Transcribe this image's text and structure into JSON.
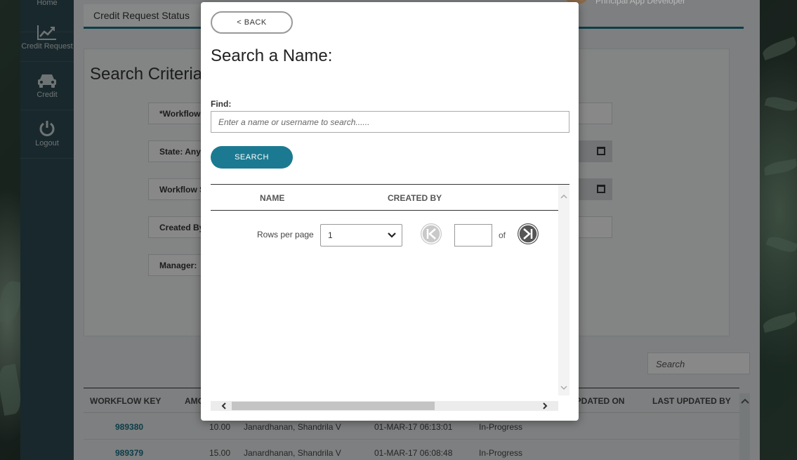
{
  "rail": {
    "items": [
      {
        "label": "Home",
        "icon": "home-icon"
      },
      {
        "label": "Credit Request",
        "icon": "trend-chart-icon"
      },
      {
        "label": "Credit",
        "icon": "car-icon"
      },
      {
        "label": "Logout",
        "icon": "power-icon"
      }
    ]
  },
  "header": {
    "user_role": "Principal App Developer"
  },
  "tabs": [
    {
      "label": "Credit Request Status"
    }
  ],
  "criteria": {
    "title": "Search Criteria",
    "fields": [
      {
        "label": "*Workflow"
      },
      {
        "label": "State:  Any"
      },
      {
        "label": "Workflow S"
      },
      {
        "label": "Created By"
      },
      {
        "label": "Manager:"
      }
    ]
  },
  "grid": {
    "search_placeholder": "Search",
    "columns": [
      "WORKFLOW KEY",
      "AMO",
      "UPDATED ON",
      "LAST UPDATED BY"
    ],
    "rows": [
      {
        "key": "989380",
        "amount": "10.00",
        "name": "Janardhanan, Shandrila V",
        "date": "01-MAR-17 06:13:01",
        "status": "In-Progress"
      },
      {
        "key": "989379",
        "amount": "15.00",
        "name": "Janardhanan, Shandrila V",
        "date": "01-MAR-17 06:08:48",
        "status": "In-Progress"
      }
    ]
  },
  "modal": {
    "back_label": "< BACK",
    "title": "Search a Name:",
    "find_label": "Find:",
    "find_placeholder": "Enter a name or username to search......",
    "search_label": "SEARCH",
    "columns": [
      "NAME",
      "CREATED BY"
    ],
    "rows_per_page_label": "Rows per page",
    "rows_per_page_value": "1",
    "page_value": "",
    "of_label": "of"
  },
  "colors": {
    "accent": "#1b7a91",
    "rail": "#2f4950",
    "link": "#1b6f84"
  }
}
